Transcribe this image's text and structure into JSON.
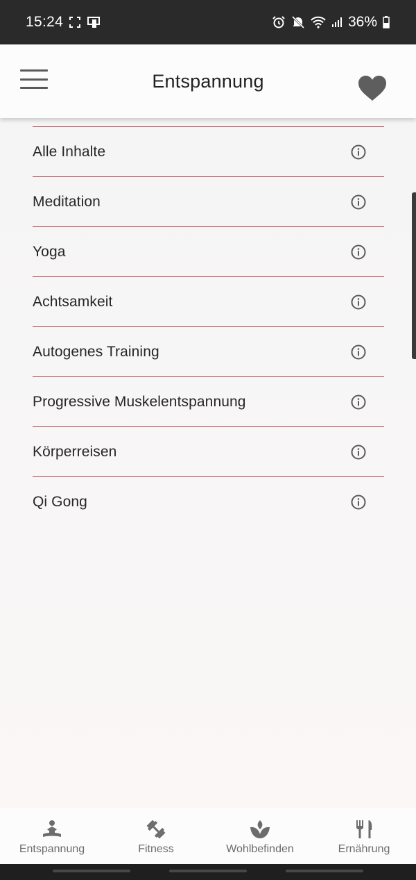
{
  "status": {
    "time": "15:24",
    "battery": "36%",
    "icons": [
      "screenshot-icon",
      "sim-icon",
      "alarm-icon",
      "mute-icon",
      "wifi-icon",
      "signal-icon",
      "battery-icon"
    ]
  },
  "header": {
    "title": "Entspannung",
    "menu_icon": "hamburger-menu-icon",
    "favorite_icon": "heart-icon"
  },
  "list": {
    "items": [
      {
        "label": "Alle Inhalte",
        "icon": "info-icon"
      },
      {
        "label": "Meditation",
        "icon": "info-icon"
      },
      {
        "label": "Yoga",
        "icon": "info-icon"
      },
      {
        "label": "Achtsamkeit",
        "icon": "info-icon"
      },
      {
        "label": "Autogenes Training",
        "icon": "info-icon"
      },
      {
        "label": "Progressive Muskelentspannung",
        "icon": "info-icon"
      },
      {
        "label": "Körperreisen",
        "icon": "info-icon"
      },
      {
        "label": "Qi Gong",
        "icon": "info-icon"
      }
    ]
  },
  "bottom_nav": {
    "items": [
      {
        "label": "Entspannung",
        "icon": "meditation-icon"
      },
      {
        "label": "Fitness",
        "icon": "dumbbell-icon"
      },
      {
        "label": "Wohlbefinden",
        "icon": "lotus-icon"
      },
      {
        "label": "Ernährung",
        "icon": "fork-knife-icon"
      }
    ]
  },
  "colors": {
    "divider": "#8e4a52",
    "text": "#262626",
    "icon": "#5a5a5a",
    "nav_text": "#6c6c6c"
  }
}
